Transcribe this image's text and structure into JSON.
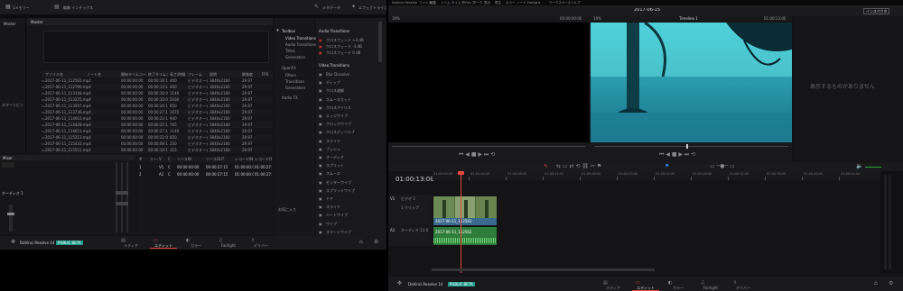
{
  "left": {
    "topbar": {
      "media_storage": "1メモリー",
      "media_pool": "編集 インデックス",
      "metadata": "メタデータ",
      "effects_library": "エフェクトライブラリ"
    },
    "bins": {
      "master": "Master",
      "master_header": "Master",
      "smart_bins": "スマートビン"
    },
    "media_columns": [
      "ファイル名",
      "ノート名",
      "開始タイムコード",
      "終了タイムコード",
      "長さ/時間",
      "フレーム",
      "説明",
      "解像度",
      "FPS"
    ],
    "media_rows": [
      [
        "2017-06-11_112562.mp4",
        "",
        "00:00:00:00",
        "00:00:16:15",
        "400",
        "ビデオオーディオ",
        "3840x2160",
        "29.97"
      ],
      [
        "2017-06-11_112790.mp4",
        "",
        "00:00:00:00",
        "00:00:13:15",
        "400",
        "ビデオオーディオ",
        "3840x2160",
        "29.97"
      ],
      [
        "2017-06-11_113148.mp4",
        "",
        "00:00:00:00",
        "00:00:16:00",
        "1140",
        "ビデオオーディオ",
        "3840x2160",
        "29.97"
      ],
      [
        "2017-06-11_113225.mp4",
        "",
        "00:00:00:00",
        "00:00:10:00",
        "2160",
        "ビデオオーディオ",
        "3840x2160",
        "29.97"
      ],
      [
        "2017-06-11_113507.mp4",
        "",
        "00:00:00:00",
        "00:00:24:15",
        "850",
        "ビデオオーディオ",
        "3840x2160",
        "29.97"
      ],
      [
        "2017-06-11_113736.mp4",
        "",
        "00:00:00:00",
        "00:00:27:15",
        "1070",
        "ビデオオーディオ",
        "3840x2160",
        "29.97"
      ],
      [
        "2017-06-11_114003.mp4",
        "",
        "00:00:00:00",
        "00:00:22:15",
        "940",
        "ビデオオーディオ",
        "3840x2160",
        "29.97"
      ],
      [
        "2017-06-11_114428.mp4",
        "",
        "00:00:00:00",
        "00:00:25:15",
        "765",
        "ビデオオーディオ",
        "3840x2160",
        "29.97"
      ],
      [
        "2017-06-11_114653.mp4",
        "",
        "00:00:00:00",
        "00:00:27:15",
        "1140",
        "ビデオオーディオ",
        "3840x2160",
        "29.97"
      ],
      [
        "2017-06-11_115213.mp4",
        "",
        "00:00:00:00",
        "00:00:22:00",
        "850",
        "ビデオオーディオ",
        "3840x2160",
        "29.97"
      ],
      [
        "2017-06-11_115433.mp4",
        "",
        "00:00:00:00",
        "00:00:08:15",
        "250",
        "ビデオオーディオ",
        "3840x2160",
        "29.97"
      ],
      [
        "2017-06-11_115551.mp4",
        "",
        "00:00:00:00",
        "00:00:10:15",
        "315",
        "ビデオオーディオ",
        "3840x2160",
        "29.97"
      ]
    ],
    "toolbox": {
      "header": "Toolbox",
      "items": [
        "Video Transitions",
        "Audio Transitions",
        "Titles",
        "Generators"
      ],
      "openfx": "OpenFX",
      "openfx_items": [
        "Filters",
        "Transitions",
        "Generators"
      ],
      "audiofx": "Audio FX",
      "favorites": "お気に入り"
    },
    "audio_transitions": {
      "header": "Audio Transitions",
      "items": [
        "クロスフェード +3 dB",
        "クロスフェード -3 dB",
        "クロスフェード 0 dB"
      ]
    },
    "video_transitions": {
      "header": "Video Transitions",
      "items": [
        "Blur Dissolve",
        "ディップ",
        "クロス溶解",
        "スムースカット",
        "クロスアイリス",
        "エッジワイプ",
        "クロックワイプ",
        "クロスディゾルブ",
        "スライド",
        "プッシュ",
        "オーディオ",
        "スプリット",
        "スムース",
        "センターワイプ",
        "スプリットワイプ",
        "ドア",
        "スライド",
        "ハートワイプ",
        "ワイプ",
        "スマートワイプ",
        "アイリス"
      ]
    },
    "mixer": {
      "header": "Mixer",
      "channels": [
        "A1",
        "M1",
        "M2"
      ],
      "bus_label": "オーディオ 1"
    },
    "edit_index": {
      "columns": [
        "#",
        "リール",
        "V",
        "C",
        "ソースIN",
        "ソースOUT",
        "レコードIN",
        "レコードOUT"
      ],
      "rows": [
        [
          "1",
          "",
          "V1",
          "C",
          "00:00:00:00",
          "00:00:27:15",
          "01:00:00:00",
          "01:00:27:15"
        ],
        [
          "2",
          "",
          "A1",
          "C",
          "00:00:00:00",
          "00:00:27:15",
          "01:00:00:00",
          "01:00:27:15"
        ]
      ]
    },
    "bottombar": {
      "app_name": "DaVinci Resolve 14",
      "beta": "PUBLIC BETA",
      "pages": [
        "メディア",
        "エディット",
        "カラー",
        "Fairlight",
        "デリバー"
      ],
      "active_page": 1
    }
  },
  "right": {
    "menubar": {
      "items": [
        "DaVinci Resolve",
        "ファイル",
        "編集",
        "トリム",
        "タイムライン",
        "クリップ",
        "マーク",
        "表示",
        "再生",
        "カラー",
        "ノード",
        "Fairlight",
        "ワークスペース",
        "ヘルプ"
      ]
    },
    "title": "2017-06-15",
    "source_zoom": "19%",
    "source_tc": "00:00:00:00",
    "source_dur": "00:00:00:00",
    "timeline_zoom": "19%",
    "timeline_name": "Timeline 1",
    "timeline_tc": "01:00:13:00",
    "inspector_button": "インスペクタ",
    "inspector_empty": "表示するものがありません",
    "timecode": "01:00:13:00",
    "ruler_ticks": [
      "01:00:00:00",
      "01:00:04:00",
      "01:00:08:00",
      "01:00:12:00",
      "01:00:16:00",
      "01:00:20:00",
      "01:00:24:00",
      "01:00:28:00",
      "01:00:32:00",
      "01:00:36:00",
      "01:00:40:00",
      "01:00:44:00"
    ],
    "video_track": {
      "id": "V1",
      "name": "ビデオ 1",
      "sub": "1 クリップ"
    },
    "audio_track": {
      "id": "A1",
      "name": "オーディオ 1",
      "level": "2.0"
    },
    "video_clip": "2017-06-11_112562",
    "audio_clip": "2017-06-11_112562",
    "bottombar": {
      "app_name": "DaVinci Resolve 14",
      "beta": "PUBLIC BETA",
      "pages": [
        "メディア",
        "エディット",
        "カラー",
        "Fairlight",
        "デリバー"
      ],
      "active_page": 1
    }
  },
  "colors": {
    "accent": "#e8463e",
    "clip_video": "#3a6a8c",
    "clip_audio": "#2e7d3a",
    "water": "#2ea6b4",
    "beta_bg": "#1e9b8a"
  }
}
